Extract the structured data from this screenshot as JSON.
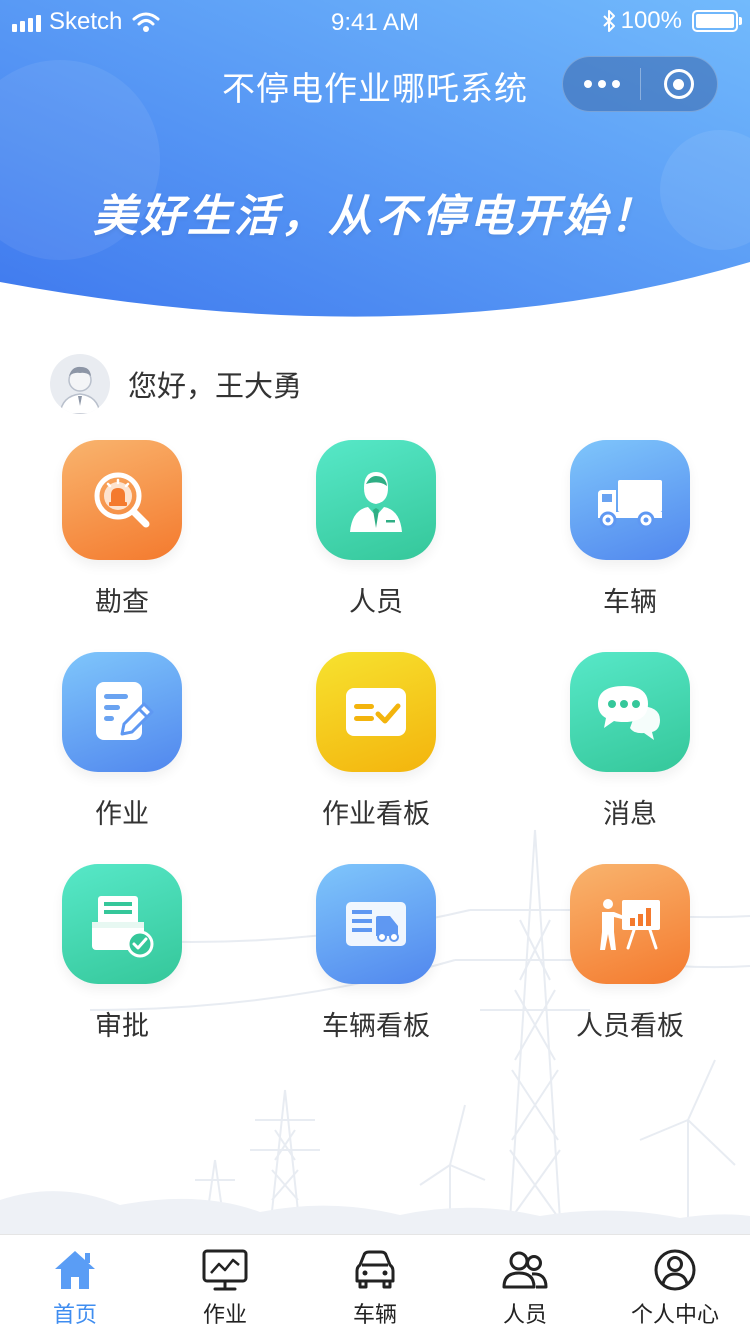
{
  "status_bar": {
    "carrier": "Sketch",
    "time": "9:41 AM",
    "battery": "100%"
  },
  "nav": {
    "title": "不停电作业哪吒系统"
  },
  "banner": {
    "slogan": "美好生活，从不停电开始！"
  },
  "greeting": {
    "text": "您好，王大勇"
  },
  "menu": [
    {
      "label": "勘查",
      "icon": "inspection-search-icon",
      "color": "#f58a3c"
    },
    {
      "label": "人员",
      "icon": "person-icon",
      "color": "#3fd3ab"
    },
    {
      "label": "车辆",
      "icon": "truck-icon",
      "color": "#5f98f2"
    },
    {
      "label": "作业",
      "icon": "edit-document-icon",
      "color": "#5f98f2"
    },
    {
      "label": "作业看板",
      "icon": "task-check-board-icon",
      "color": "#f4c31a"
    },
    {
      "label": "消息",
      "icon": "chat-bubbles-icon",
      "color": "#3fd3ab"
    },
    {
      "label": "审批",
      "icon": "approval-printer-icon",
      "color": "#3fd3ab"
    },
    {
      "label": "车辆看板",
      "icon": "vehicle-board-icon",
      "color": "#5f98f2"
    },
    {
      "label": "人员看板",
      "icon": "presentation-board-icon",
      "color": "#f58a3c"
    }
  ],
  "tabbar": {
    "items": [
      {
        "label": "首页",
        "icon": "home-icon",
        "active": true
      },
      {
        "label": "作业",
        "icon": "monitor-chart-icon",
        "active": false
      },
      {
        "label": "车辆",
        "icon": "car-icon",
        "active": false
      },
      {
        "label": "人员",
        "icon": "people-icon",
        "active": false
      },
      {
        "label": "个人中心",
        "icon": "user-circle-icon",
        "active": false
      }
    ],
    "active_color": "#3f8df0"
  },
  "colors": {
    "header_start": "#4a86f2",
    "header_end": "#6fb8fb"
  }
}
